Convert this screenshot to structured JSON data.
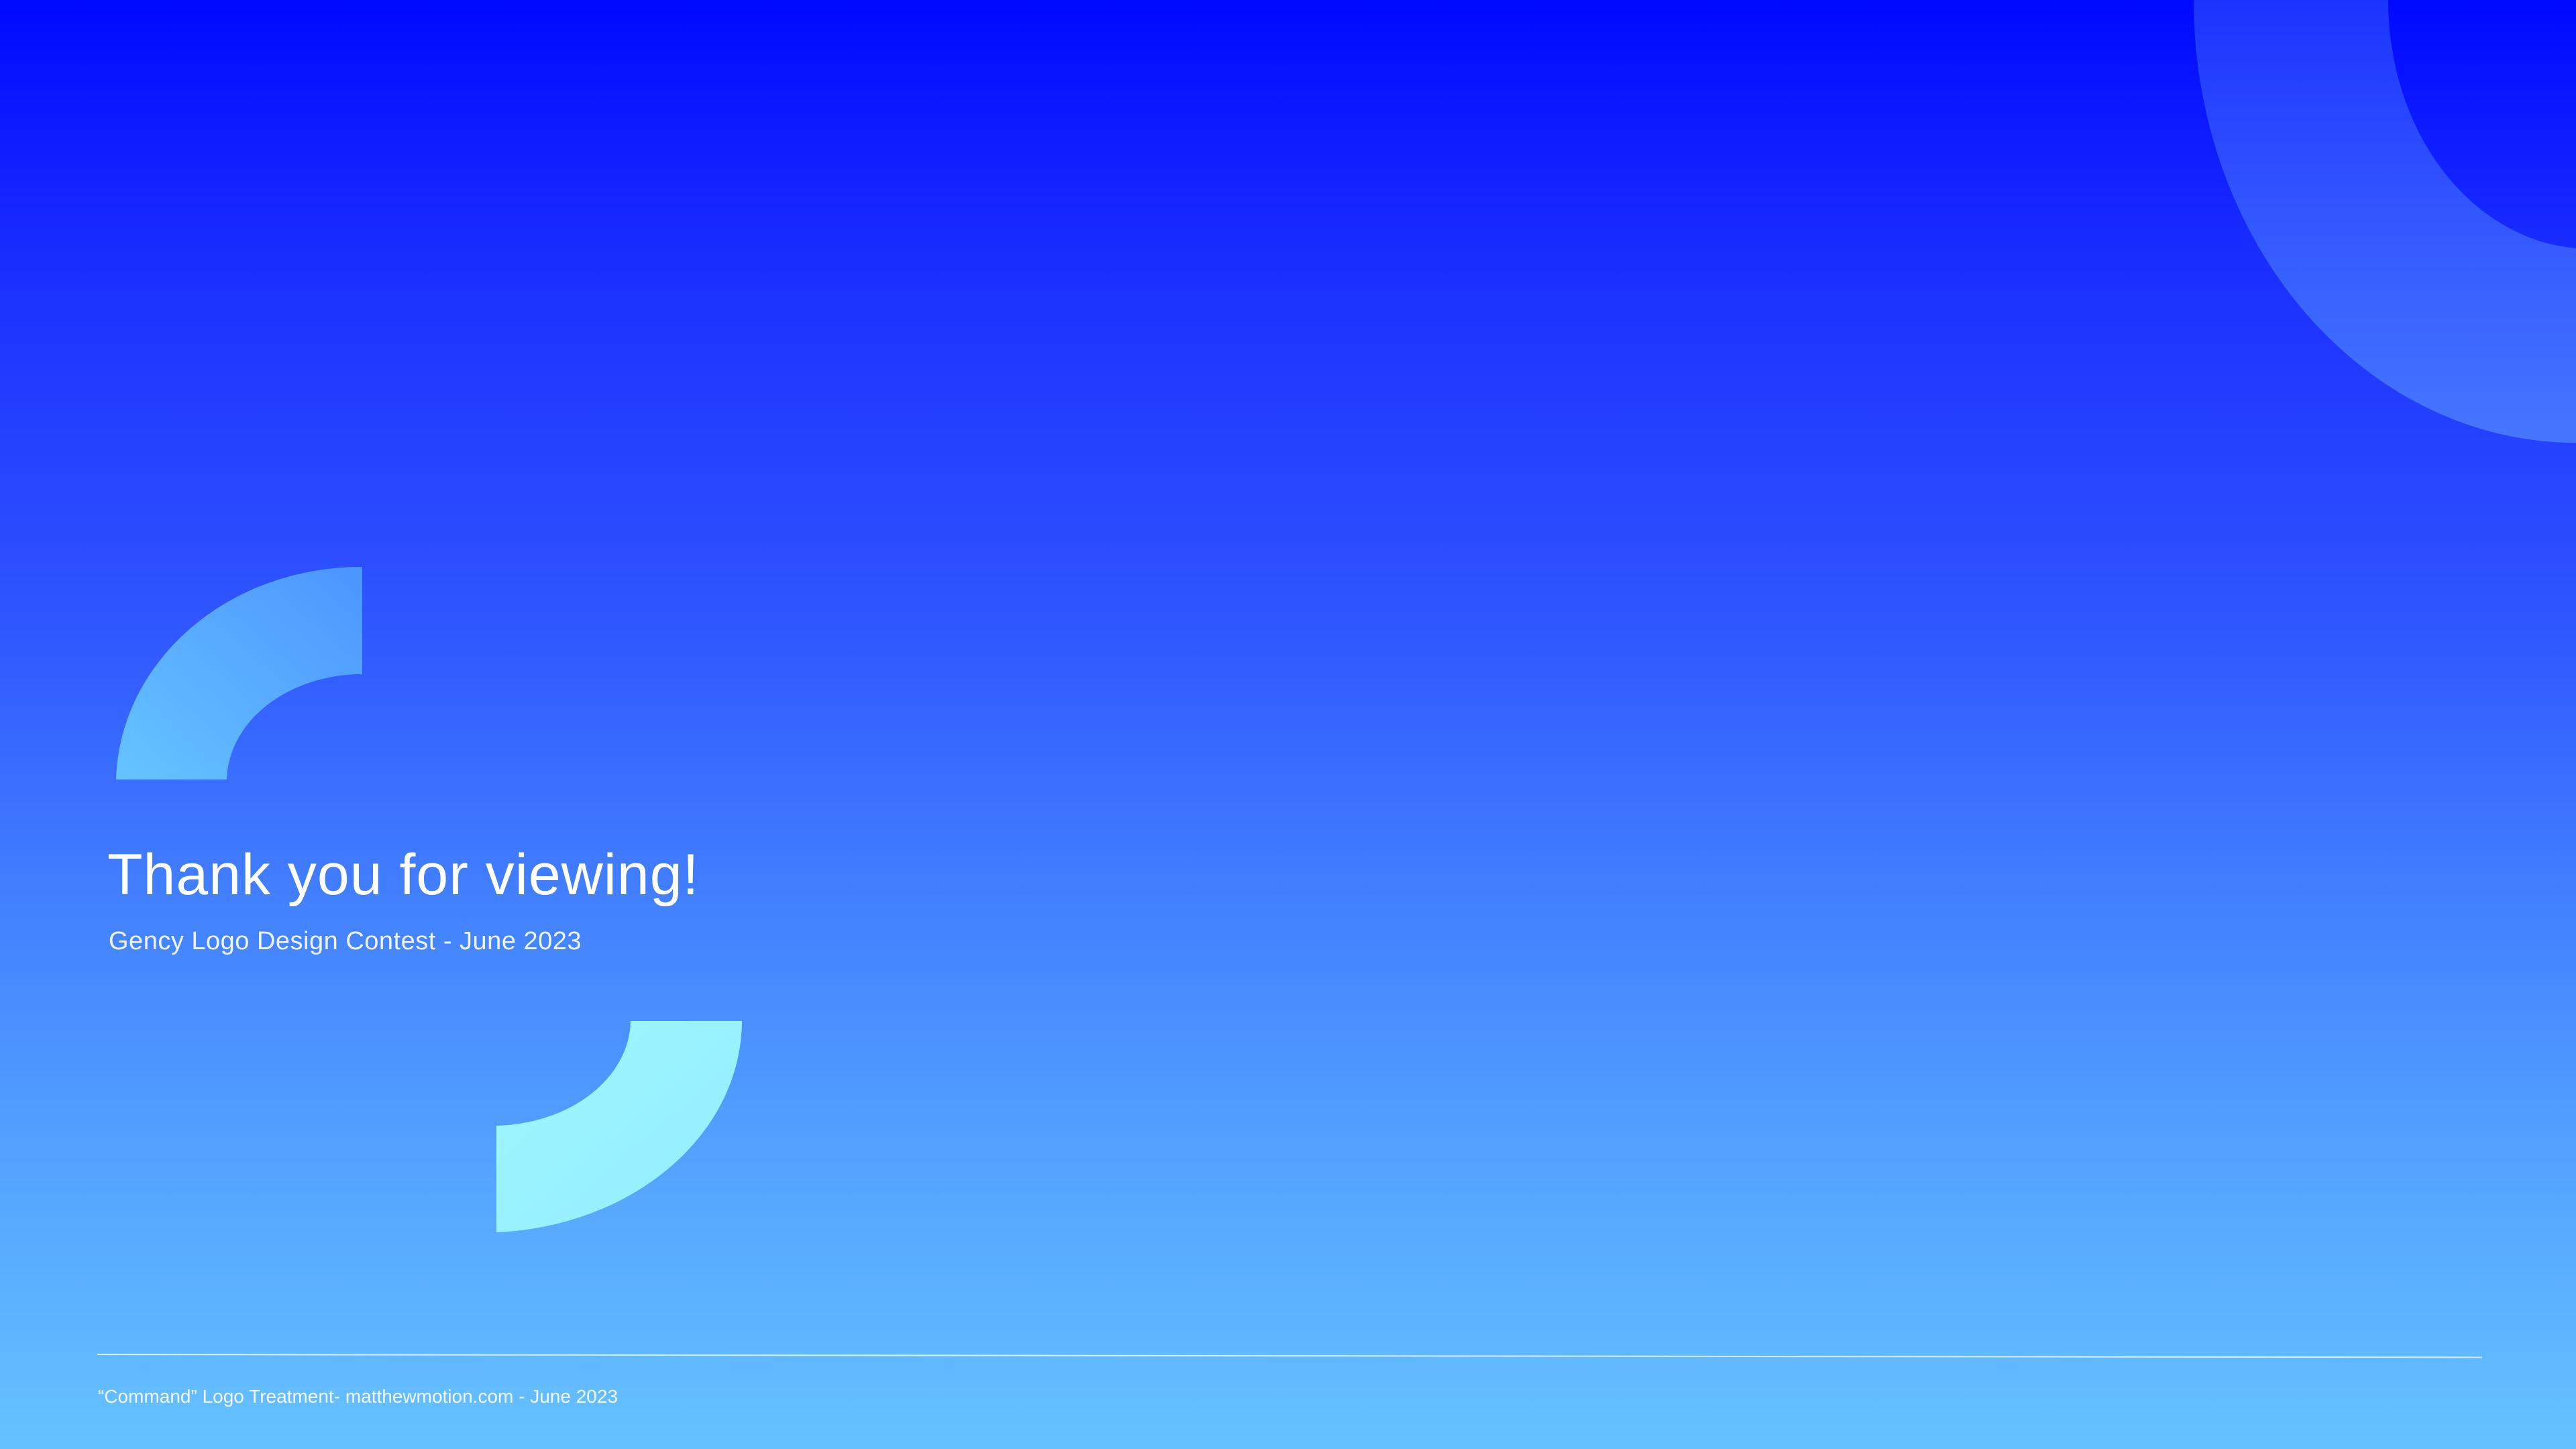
{
  "slide": {
    "title": "Thank you for viewing!",
    "subtitle": "Gency Logo Design Contest - June 2023",
    "footer": "“Command” Logo Treatment- matthewmotion.com - June 2023"
  },
  "decorations": {
    "top_right_arc": "quarter-ring-shape",
    "left_arc": "quarter-ring-shape",
    "bottom_arc": "quarter-ring-shape"
  },
  "colors": {
    "background_top": "#0008ff",
    "background_bottom": "#66c2ff",
    "left_arc": "#55a8ff",
    "bottom_arc": "#99f5ff",
    "top_right_arc": "#3c6cff",
    "text": "#ffffff"
  }
}
